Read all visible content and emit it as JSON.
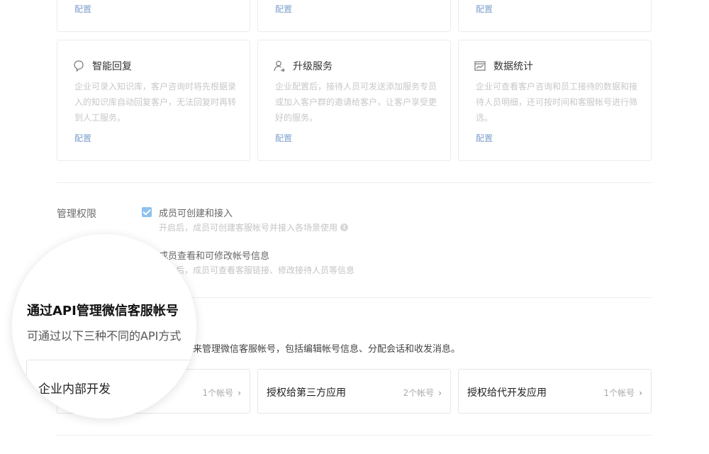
{
  "top_cards": [
    {
      "config_label": "配置"
    },
    {
      "config_label": "配置"
    },
    {
      "config_label": "配置"
    }
  ],
  "feature_cards": [
    {
      "icon": "chat-bubble-icon",
      "title": "智能回复",
      "desc": "企业可录入知识库，客户咨询时将先根据录入的知识库自动回复客户，无法回复时再转到人工服务。",
      "config_label": "配置"
    },
    {
      "icon": "person-upgrade-icon",
      "title": "升级服务",
      "desc": "企业配置后，接待人员可发送添加服务专员或加入客户群的邀请给客户，让客户享受更好的服务。",
      "config_label": "配置"
    },
    {
      "icon": "chart-icon",
      "title": "数据统计",
      "desc": "企业可查看客户咨询和员工接待的数据和接待人员明细，还可按时间和客服帐号进行筛选。",
      "config_label": "配置"
    }
  ],
  "permissions": {
    "label": "管理权限",
    "options": [
      {
        "checked": true,
        "title": "成员可创建和接入",
        "desc": "开启后，成员可创建客服帐号并接入各场景使用"
      },
      {
        "checked": false,
        "title": "成员查看和可修改帐号信息",
        "desc": "开启后，成员可查看客服链接、修改接待人员等信息"
      }
    ]
  },
  "api_section": {
    "title": "通过API管理微信客服帐号",
    "subtitle": "可通过以下三种不同的API方式",
    "desc_visible": "来管理微信客服帐号，包括编辑帐号信息、分配会话和收发消息。",
    "cards": [
      {
        "name": "企业内部开发",
        "count": "1个帐号"
      },
      {
        "name": "授权给第三方应用",
        "count": "2个帐号"
      },
      {
        "name": "授权给代开发应用",
        "count": "1个帐号"
      }
    ]
  }
}
